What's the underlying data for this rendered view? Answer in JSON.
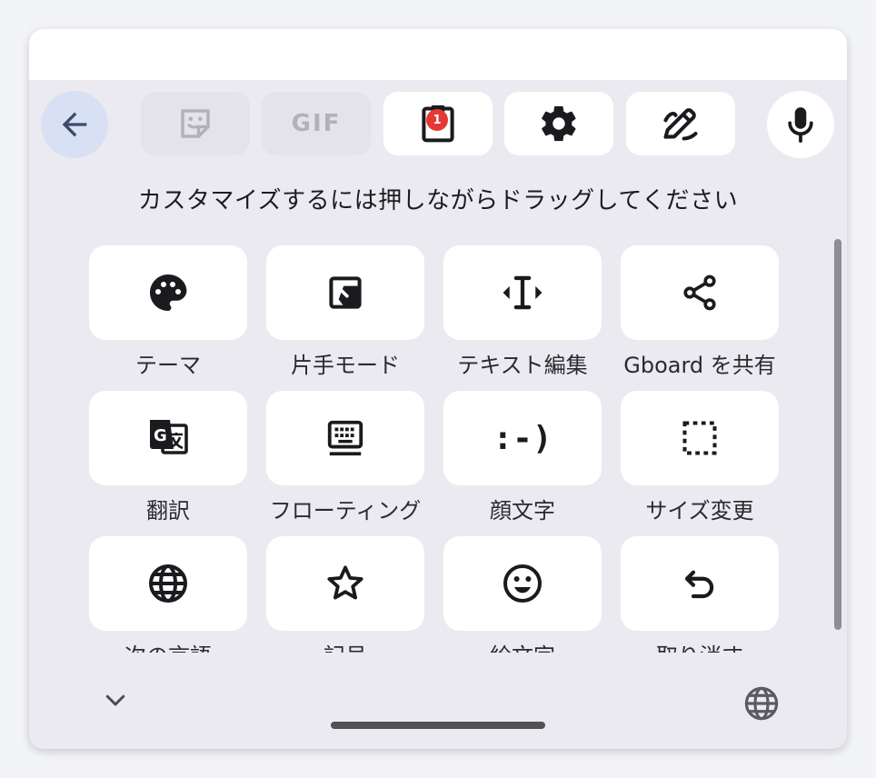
{
  "toolbar": {
    "back_icon": "arrow-left-icon",
    "items": [
      {
        "icon": "sticker-icon",
        "enabled": false
      },
      {
        "icon": "gif-icon",
        "text": "GIF",
        "enabled": false
      },
      {
        "icon": "clipboard-icon",
        "badge": "1",
        "enabled": true
      },
      {
        "icon": "gear-icon",
        "enabled": true
      },
      {
        "icon": "handwriting-pen-icon",
        "enabled": true
      }
    ],
    "mic_icon": "microphone-icon"
  },
  "hint": "カスタマイズするには押しながらドラッグしてください",
  "tiles": [
    {
      "icon": "palette-icon",
      "label": "テーマ"
    },
    {
      "icon": "one-hand-mode-icon",
      "label": "片手モード"
    },
    {
      "icon": "text-cursor-icon",
      "label": "テキスト編集"
    },
    {
      "icon": "share-icon",
      "label": "Gboard を共有"
    },
    {
      "icon": "translate-icon",
      "label": "翻訳"
    },
    {
      "icon": "floating-keyboard-icon",
      "label": "フローティング"
    },
    {
      "icon": "emoticon-icon",
      "text": ":-)",
      "label": "顔文字"
    },
    {
      "icon": "resize-icon",
      "label": "サイズ変更"
    },
    {
      "icon": "globe-icon",
      "label": "次の言語"
    },
    {
      "icon": "star-icon",
      "label": "記号"
    },
    {
      "icon": "smiley-icon",
      "label": "絵文字"
    },
    {
      "icon": "undo-icon",
      "label": "取り消す"
    }
  ],
  "bottom": {
    "collapse_icon": "chevron-down-icon",
    "language_icon": "globe-icon"
  },
  "colors": {
    "panel_bg": "#eceaf1",
    "tile_bg": "#ffffff",
    "back_bg": "#d8e0f4",
    "badge": "#e53935",
    "icon": "#1b1b1f",
    "disabled_icon": "#b2b1b8"
  }
}
